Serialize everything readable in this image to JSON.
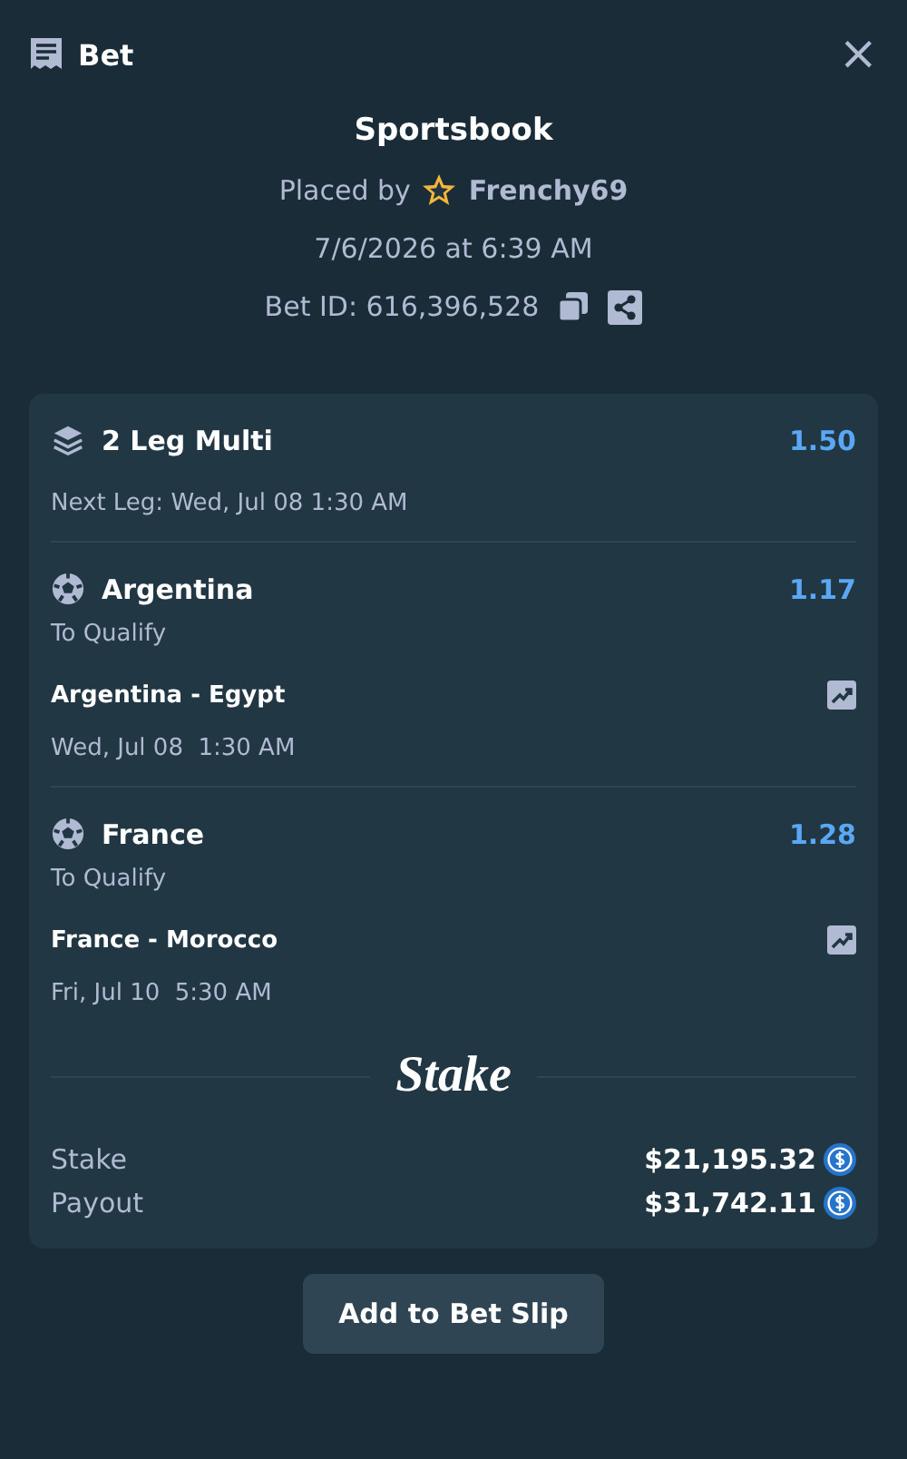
{
  "header": {
    "title": "Bet",
    "close": "×"
  },
  "summary": {
    "title": "Sportsbook",
    "placed_by": "Placed by",
    "user": "Frenchy69",
    "date": "7/6/2026 at 6:39 AM",
    "bet_id": "Bet ID: 616,396,528"
  },
  "multi": {
    "title": "2 Leg Multi",
    "odds": "1.50",
    "next_leg": "Next Leg: Wed, Jul 08 1:30 AM"
  },
  "legs": [
    {
      "team": "Argentina",
      "odds": "1.17",
      "market": "To Qualify",
      "match": "Argentina - Egypt",
      "time": "Wed, Jul 08  1:30 AM"
    },
    {
      "team": "France",
      "odds": "1.28",
      "market": "To Qualify",
      "match": "France - Morocco",
      "time": "Fri, Jul 10  5:30 AM"
    }
  ],
  "logo": "Stake",
  "totals": [
    {
      "label": "Stake",
      "amount": "$21,195.32"
    },
    {
      "label": "Payout",
      "amount": "$31,742.11"
    }
  ],
  "button": "Add to Bet Slip"
}
